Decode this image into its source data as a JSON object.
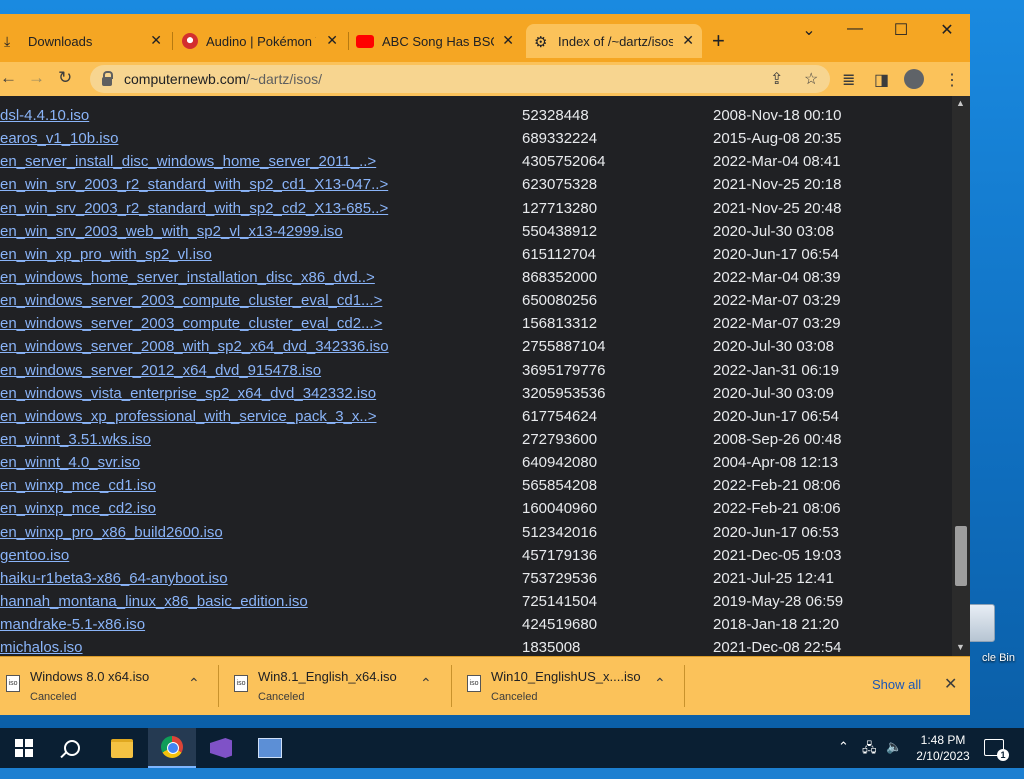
{
  "browser": {
    "tabs": [
      {
        "title": "Downloads",
        "active": false
      },
      {
        "title": "Audino | Pokémon W",
        "active": false
      },
      {
        "title": "ABC Song Has BSOD",
        "active": false
      },
      {
        "title": "Index of /~dartz/isos",
        "active": true
      }
    ],
    "url_host": "computernewb.com",
    "url_path": "/~dartz/isos/"
  },
  "listing": [
    {
      "name": "dsl-4.4.10.iso",
      "size": "52328448",
      "date": "2008-Nov-18 00:10"
    },
    {
      "name": "earos_v1_10b.iso",
      "size": "689332224",
      "date": "2015-Aug-08 20:35"
    },
    {
      "name": "en_server_install_disc_windows_home_server_2011_..>",
      "size": "4305752064",
      "date": "2022-Mar-04 08:41"
    },
    {
      "name": "en_win_srv_2003_r2_standard_with_sp2_cd1_X13-047..>",
      "size": "623075328",
      "date": "2021-Nov-25 20:18"
    },
    {
      "name": "en_win_srv_2003_r2_standard_with_sp2_cd2_X13-685..>",
      "size": "127713280",
      "date": "2021-Nov-25 20:48"
    },
    {
      "name": "en_win_srv_2003_web_with_sp2_vl_x13-42999.iso",
      "size": "550438912",
      "date": "2020-Jul-30 03:08"
    },
    {
      "name": "en_win_xp_pro_with_sp2_vl.iso",
      "size": "615112704",
      "date": "2020-Jun-17 06:54"
    },
    {
      "name": "en_windows_home_server_installation_disc_x86_dvd..>",
      "size": "868352000",
      "date": "2022-Mar-04 08:39"
    },
    {
      "name": "en_windows_server_2003_compute_cluster_eval_cd1...>",
      "size": "650080256",
      "date": "2022-Mar-07 03:29"
    },
    {
      "name": "en_windows_server_2003_compute_cluster_eval_cd2...>",
      "size": "156813312",
      "date": "2022-Mar-07 03:29"
    },
    {
      "name": "en_windows_server_2008_with_sp2_x64_dvd_342336.iso",
      "size": "2755887104",
      "date": "2020-Jul-30 03:08"
    },
    {
      "name": "en_windows_server_2012_x64_dvd_915478.iso",
      "size": "3695179776",
      "date": "2022-Jan-31 06:19"
    },
    {
      "name": "en_windows_vista_enterprise_sp2_x64_dvd_342332.iso",
      "size": "3205953536",
      "date": "2020-Jul-30 03:09"
    },
    {
      "name": "en_windows_xp_professional_with_service_pack_3_x..>",
      "size": "617754624",
      "date": "2020-Jun-17 06:54"
    },
    {
      "name": "en_winnt_3.51.wks.iso",
      "size": "272793600",
      "date": "2008-Sep-26 00:48"
    },
    {
      "name": "en_winnt_4.0_svr.iso",
      "size": "640942080",
      "date": "2004-Apr-08 12:13"
    },
    {
      "name": "en_winxp_mce_cd1.iso",
      "size": "565854208",
      "date": "2022-Feb-21 08:06"
    },
    {
      "name": "en_winxp_mce_cd2.iso",
      "size": "160040960",
      "date": "2022-Feb-21 08:06"
    },
    {
      "name": "en_winxp_pro_x86_build2600.iso",
      "size": "512342016",
      "date": "2020-Jun-17 06:53"
    },
    {
      "name": "gentoo.iso",
      "size": "457179136",
      "date": "2021-Dec-05 19:03"
    },
    {
      "name": "haiku-r1beta3-x86_64-anyboot.iso",
      "size": "753729536",
      "date": "2021-Jul-25 12:41"
    },
    {
      "name": "hannah_montana_linux_x86_basic_edition.iso",
      "size": "725141504",
      "date": "2019-May-28 06:59"
    },
    {
      "name": "mandrake-5.1-x86.iso",
      "size": "424519680",
      "date": "2018-Jan-18 21:20"
    },
    {
      "name": "michalos.iso",
      "size": "1835008",
      "date": "2021-Dec-08 22:54"
    }
  ],
  "downloads": [
    {
      "name": "Windows 8.0 x64.iso",
      "status": "Canceled"
    },
    {
      "name": "Win8.1_English_x64.iso",
      "status": "Canceled"
    },
    {
      "name": "Win10_EnglishUS_x....iso",
      "status": "Canceled"
    }
  ],
  "shelf": {
    "show_all": "Show all"
  },
  "desktop": {
    "recycle_bin_label": "cle Bin"
  },
  "taskbar": {
    "time": "1:48 PM",
    "date": "2/10/2023",
    "notification_count": "1"
  },
  "colors": {
    "accent": "#f5a623",
    "link": "#8ab4f8",
    "page_bg": "#202124"
  }
}
